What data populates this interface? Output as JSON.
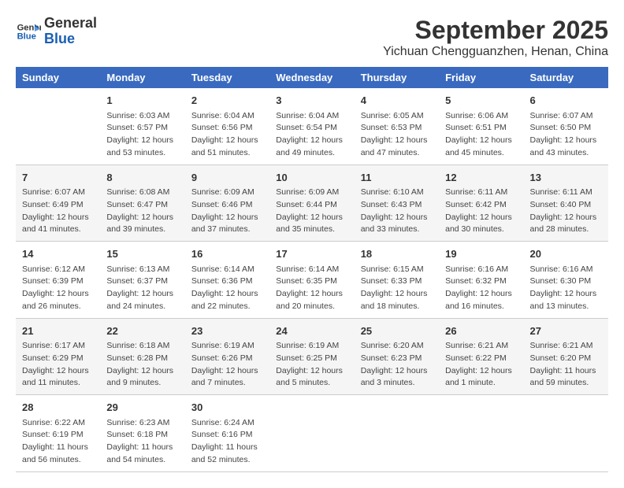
{
  "header": {
    "logo_line1": "General",
    "logo_line2": "Blue",
    "title": "September 2025",
    "subtitle": "Yichuan Chengguanzhen, Henan, China"
  },
  "weekdays": [
    "Sunday",
    "Monday",
    "Tuesday",
    "Wednesday",
    "Thursday",
    "Friday",
    "Saturday"
  ],
  "weeks": [
    [
      {
        "day": "",
        "info": ""
      },
      {
        "day": "1",
        "info": "Sunrise: 6:03 AM\nSunset: 6:57 PM\nDaylight: 12 hours\nand 53 minutes."
      },
      {
        "day": "2",
        "info": "Sunrise: 6:04 AM\nSunset: 6:56 PM\nDaylight: 12 hours\nand 51 minutes."
      },
      {
        "day": "3",
        "info": "Sunrise: 6:04 AM\nSunset: 6:54 PM\nDaylight: 12 hours\nand 49 minutes."
      },
      {
        "day": "4",
        "info": "Sunrise: 6:05 AM\nSunset: 6:53 PM\nDaylight: 12 hours\nand 47 minutes."
      },
      {
        "day": "5",
        "info": "Sunrise: 6:06 AM\nSunset: 6:51 PM\nDaylight: 12 hours\nand 45 minutes."
      },
      {
        "day": "6",
        "info": "Sunrise: 6:07 AM\nSunset: 6:50 PM\nDaylight: 12 hours\nand 43 minutes."
      }
    ],
    [
      {
        "day": "7",
        "info": "Sunrise: 6:07 AM\nSunset: 6:49 PM\nDaylight: 12 hours\nand 41 minutes."
      },
      {
        "day": "8",
        "info": "Sunrise: 6:08 AM\nSunset: 6:47 PM\nDaylight: 12 hours\nand 39 minutes."
      },
      {
        "day": "9",
        "info": "Sunrise: 6:09 AM\nSunset: 6:46 PM\nDaylight: 12 hours\nand 37 minutes."
      },
      {
        "day": "10",
        "info": "Sunrise: 6:09 AM\nSunset: 6:44 PM\nDaylight: 12 hours\nand 35 minutes."
      },
      {
        "day": "11",
        "info": "Sunrise: 6:10 AM\nSunset: 6:43 PM\nDaylight: 12 hours\nand 33 minutes."
      },
      {
        "day": "12",
        "info": "Sunrise: 6:11 AM\nSunset: 6:42 PM\nDaylight: 12 hours\nand 30 minutes."
      },
      {
        "day": "13",
        "info": "Sunrise: 6:11 AM\nSunset: 6:40 PM\nDaylight: 12 hours\nand 28 minutes."
      }
    ],
    [
      {
        "day": "14",
        "info": "Sunrise: 6:12 AM\nSunset: 6:39 PM\nDaylight: 12 hours\nand 26 minutes."
      },
      {
        "day": "15",
        "info": "Sunrise: 6:13 AM\nSunset: 6:37 PM\nDaylight: 12 hours\nand 24 minutes."
      },
      {
        "day": "16",
        "info": "Sunrise: 6:14 AM\nSunset: 6:36 PM\nDaylight: 12 hours\nand 22 minutes."
      },
      {
        "day": "17",
        "info": "Sunrise: 6:14 AM\nSunset: 6:35 PM\nDaylight: 12 hours\nand 20 minutes."
      },
      {
        "day": "18",
        "info": "Sunrise: 6:15 AM\nSunset: 6:33 PM\nDaylight: 12 hours\nand 18 minutes."
      },
      {
        "day": "19",
        "info": "Sunrise: 6:16 AM\nSunset: 6:32 PM\nDaylight: 12 hours\nand 16 minutes."
      },
      {
        "day": "20",
        "info": "Sunrise: 6:16 AM\nSunset: 6:30 PM\nDaylight: 12 hours\nand 13 minutes."
      }
    ],
    [
      {
        "day": "21",
        "info": "Sunrise: 6:17 AM\nSunset: 6:29 PM\nDaylight: 12 hours\nand 11 minutes."
      },
      {
        "day": "22",
        "info": "Sunrise: 6:18 AM\nSunset: 6:28 PM\nDaylight: 12 hours\nand 9 minutes."
      },
      {
        "day": "23",
        "info": "Sunrise: 6:19 AM\nSunset: 6:26 PM\nDaylight: 12 hours\nand 7 minutes."
      },
      {
        "day": "24",
        "info": "Sunrise: 6:19 AM\nSunset: 6:25 PM\nDaylight: 12 hours\nand 5 minutes."
      },
      {
        "day": "25",
        "info": "Sunrise: 6:20 AM\nSunset: 6:23 PM\nDaylight: 12 hours\nand 3 minutes."
      },
      {
        "day": "26",
        "info": "Sunrise: 6:21 AM\nSunset: 6:22 PM\nDaylight: 12 hours\nand 1 minute."
      },
      {
        "day": "27",
        "info": "Sunrise: 6:21 AM\nSunset: 6:20 PM\nDaylight: 11 hours\nand 59 minutes."
      }
    ],
    [
      {
        "day": "28",
        "info": "Sunrise: 6:22 AM\nSunset: 6:19 PM\nDaylight: 11 hours\nand 56 minutes."
      },
      {
        "day": "29",
        "info": "Sunrise: 6:23 AM\nSunset: 6:18 PM\nDaylight: 11 hours\nand 54 minutes."
      },
      {
        "day": "30",
        "info": "Sunrise: 6:24 AM\nSunset: 6:16 PM\nDaylight: 11 hours\nand 52 minutes."
      },
      {
        "day": "",
        "info": ""
      },
      {
        "day": "",
        "info": ""
      },
      {
        "day": "",
        "info": ""
      },
      {
        "day": "",
        "info": ""
      }
    ]
  ]
}
